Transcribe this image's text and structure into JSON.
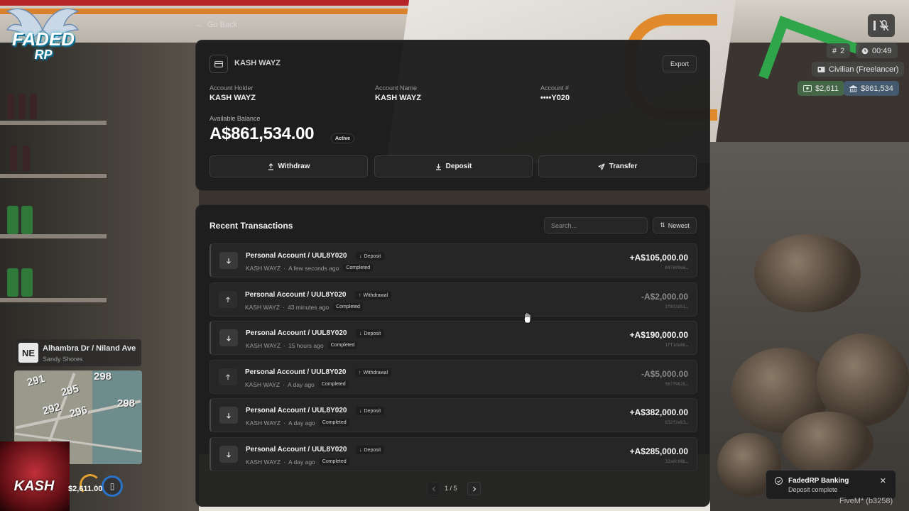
{
  "hud": {
    "logo_text": "FADED",
    "logo_sub": "RP",
    "player_id": "2",
    "time": "00:49",
    "job": "Civilian (Freelancer)",
    "cash": "$2,611",
    "bank": "$861,534",
    "street": "Alhambra Dr / Niland Ave",
    "zone": "Sandy Shores",
    "compass": "NE",
    "cash_bottom": "$2,611.00",
    "avatar_name": "KASH",
    "map_numbers": [
      "291",
      "298",
      "295",
      "292",
      "296",
      "298"
    ]
  },
  "bank": {
    "go_back": "Go Back",
    "account_title": "KASH WAYZ",
    "export_label": "Export",
    "holder_label": "Account Holder",
    "holder_value": "KASH WAYZ",
    "name_label": "Account Name",
    "name_value": "KASH WAYZ",
    "number_label": "Account #",
    "number_value": "••••Y020",
    "balance_label": "Available Balance",
    "balance_value": "A$861,534.00",
    "status": "Active",
    "actions": {
      "withdraw": "Withdraw",
      "deposit": "Deposit",
      "transfer": "Transfer"
    }
  },
  "transactions": {
    "heading": "Recent Transactions",
    "search_placeholder": "Search...",
    "sort_label": "Newest",
    "rows": [
      {
        "name": "Personal Account / UUL8Y020",
        "type": "Deposit",
        "user": "KASH WAYZ",
        "time": "A few seconds ago",
        "status": "Completed",
        "amount": "+A$105,000.00",
        "hash": "847699e6…"
      },
      {
        "name": "Personal Account / UUL8Y020",
        "type": "Withdrawal",
        "user": "KASH WAYZ",
        "time": "43 minutes ago",
        "status": "Completed",
        "amount": "-A$2,000.00",
        "hash": "1f033d51…"
      },
      {
        "name": "Personal Account / UUL8Y020",
        "type": "Deposit",
        "user": "KASH WAYZ",
        "time": "15 hours ago",
        "status": "Completed",
        "amount": "+A$190,000.00",
        "hash": "1ff1da86…"
      },
      {
        "name": "Personal Account / UUL8Y020",
        "type": "Withdrawal",
        "user": "KASH WAYZ",
        "time": "A day ago",
        "status": "Completed",
        "amount": "-A$5,000.00",
        "hash": "5b7f9828…"
      },
      {
        "name": "Personal Account / UUL8Y020",
        "type": "Deposit",
        "user": "KASH WAYZ",
        "time": "A day ago",
        "status": "Completed",
        "amount": "+A$382,000.00",
        "hash": "632f2eb3…"
      },
      {
        "name": "Personal Account / UUL8Y020",
        "type": "Deposit",
        "user": "KASH WAYZ",
        "time": "A day ago",
        "status": "Completed",
        "amount": "+A$285,000.00",
        "hash": "32adc98b…"
      }
    ],
    "page_label": "1 / 5"
  },
  "toast": {
    "title": "FadedRP Banking",
    "message": "Deposit complete"
  },
  "footer": {
    "fivem": "FiveM* (b3258)"
  }
}
